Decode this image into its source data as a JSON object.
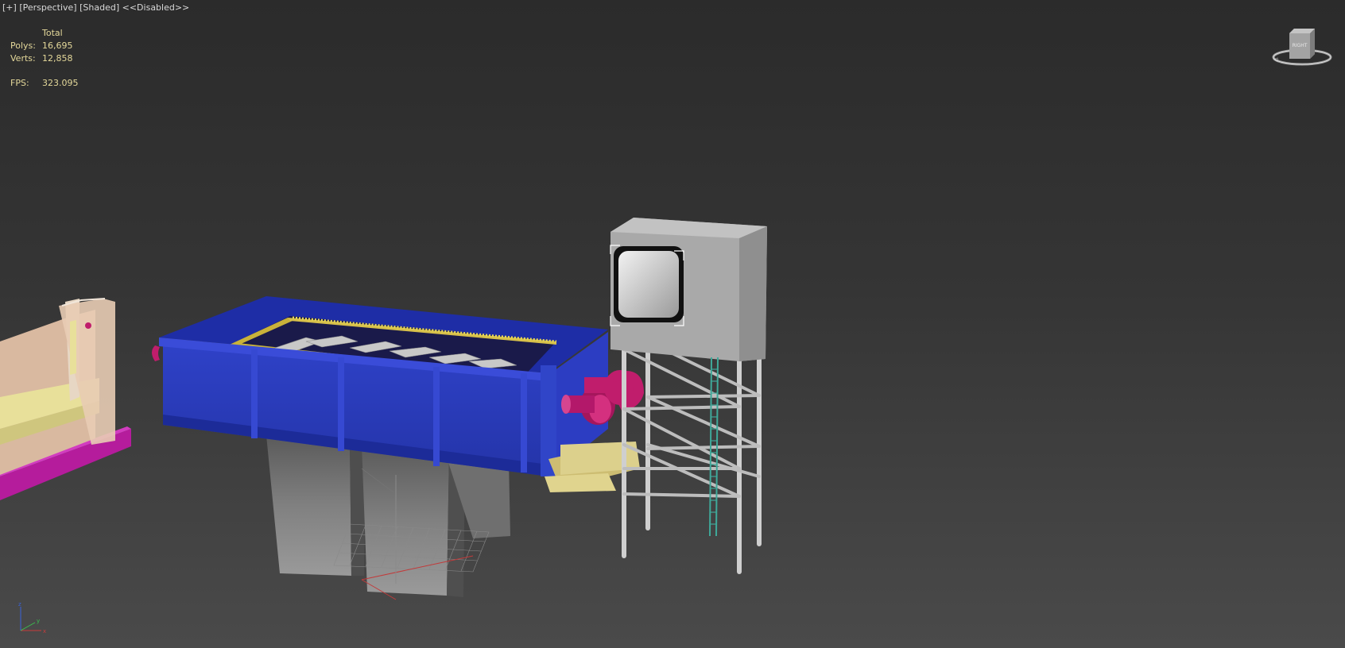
{
  "viewport": {
    "labels": {
      "plus": "[+]",
      "view": "[Perspective]",
      "shading": "[Shaded]",
      "status": "<<Disabled>>"
    },
    "stats": {
      "header": "Total",
      "polys_label": "Polys:",
      "polys_value": "16,695",
      "verts_label": "Verts:",
      "verts_value": "12,858",
      "fps_label": "FPS:",
      "fps_value": "323.095"
    },
    "viewcube": {
      "face_label": "RIGHT"
    },
    "axes": {
      "x": "x",
      "y": "y",
      "z": "z"
    },
    "colors": {
      "background_top": "#2b2b2b",
      "background_bottom": "#4a4a4a",
      "stats_text": "#e4d89a",
      "label_text": "#d8d8d8",
      "tank_blue": "#2a3bbf",
      "pipe_magenta": "#c01d6c",
      "tower_gray": "#a9a9a9",
      "ladder_teal": "#3fa99a",
      "platform_yellow": "#d9cf85"
    }
  }
}
